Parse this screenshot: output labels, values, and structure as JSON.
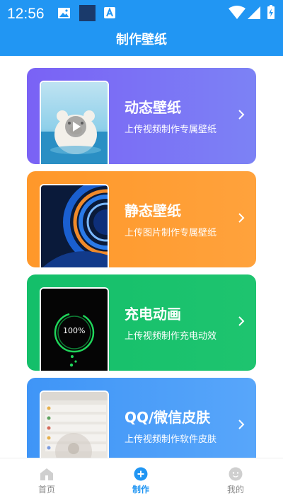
{
  "status_bar": {
    "time": "12:56"
  },
  "header": {
    "title": "制作壁纸"
  },
  "cards": [
    {
      "title": "动态壁纸",
      "subtitle": "上传视频制作专属壁纸",
      "color": "#7a6cf5"
    },
    {
      "title": "静态壁纸",
      "subtitle": "上传图片制作专属壁纸",
      "color": "#ff9a2e"
    },
    {
      "title": "充电动画",
      "subtitle": "上传视频制作充电动效",
      "color": "#19c06b",
      "thumb_text": "100%"
    },
    {
      "title": "QQ/微信皮肤",
      "subtitle": "上传视频制作软件皮肤",
      "color": "#4a9ef8"
    }
  ],
  "bottom_nav": {
    "items": [
      {
        "label": "首页",
        "icon": "home-icon"
      },
      {
        "label": "制作",
        "icon": "plus-icon",
        "active": true
      },
      {
        "label": "我的",
        "icon": "profile-icon"
      }
    ]
  },
  "colors": {
    "primary": "#2196f3",
    "inactive_nav": "#888888"
  }
}
